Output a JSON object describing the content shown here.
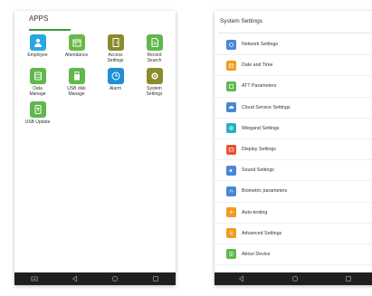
{
  "apps_screen": {
    "title": "APPS",
    "accent_color": "#3d9a3d",
    "apps": [
      {
        "label": "Employee",
        "icon": "person-icon",
        "color": "#27a8e0"
      },
      {
        "label": "Attendance",
        "icon": "calendar-icon",
        "color": "#6bb945"
      },
      {
        "label": "Access\nSettings",
        "icon": "door-lock-icon",
        "color": "#8a8b2c"
      },
      {
        "label": "Record\nSearch",
        "icon": "document-icon",
        "color": "#5fb84c"
      },
      {
        "label": "Data\nManage",
        "icon": "database-icon",
        "color": "#5fb84c"
      },
      {
        "label": "USB disk\nManage",
        "icon": "usb-drive-icon",
        "color": "#5fb84c"
      },
      {
        "label": "Alarm",
        "icon": "clock-icon",
        "color": "#1f8fd6"
      },
      {
        "label": "System\nSettings",
        "icon": "gear-icon",
        "color": "#8a8b2c"
      },
      {
        "label": "USB Update",
        "icon": "usb-update-icon",
        "color": "#5fb84c"
      }
    ]
  },
  "settings_screen": {
    "title": "System Settings",
    "items": [
      {
        "label": "Network Settings",
        "icon": "network-icon",
        "color": "#4a86d8"
      },
      {
        "label": "Date and Time",
        "icon": "calendar-icon",
        "color": "#f39a1e"
      },
      {
        "label": "ATT Parameters",
        "icon": "attendance-icon",
        "color": "#5fb84c"
      },
      {
        "label": "Cloud Service Settings",
        "icon": "cloud-icon",
        "color": "#4a86d8"
      },
      {
        "label": "Wiegand Settings",
        "icon": "wiegand-icon",
        "color": "#2ab0c8"
      },
      {
        "label": "Display Settings",
        "icon": "display-icon",
        "color": "#e8532c"
      },
      {
        "label": "Sound Settings",
        "icon": "speaker-icon",
        "color": "#4a86d8"
      },
      {
        "label": "Biometric parameters",
        "icon": "fingerprint-icon",
        "color": "#4a86d8"
      },
      {
        "label": "Auto-testing",
        "icon": "wrench-icon",
        "color": "#f39a1e"
      },
      {
        "label": "Advanced Settings",
        "icon": "sliders-icon",
        "color": "#f39a1e"
      },
      {
        "label": "About Device",
        "icon": "info-icon",
        "color": "#5fb84c"
      }
    ]
  },
  "navbar": {
    "left": [
      "keyboard-icon",
      "back-icon",
      "home-icon",
      "recent-apps-icon"
    ],
    "right": [
      "back-icon",
      "home-icon",
      "recent-apps-icon"
    ]
  }
}
